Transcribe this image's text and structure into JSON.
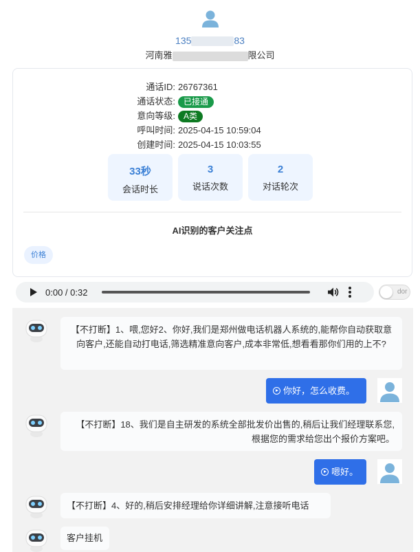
{
  "header": {
    "phone_prefix": "135",
    "phone_suffix": "83",
    "company_prefix": "河南雅",
    "company_suffix": "限公司"
  },
  "call_info": {
    "call_id_label": "通话ID:",
    "call_id": "26767361",
    "status_label": "通话状态:",
    "status": "已接通",
    "intent_label": "意向等级:",
    "intent": "A类",
    "call_time_label": "呼叫时间:",
    "call_time": "2025-04-15 10:59:04",
    "create_time_label": "创建时间:",
    "create_time": "2025-04-15 10:03:55"
  },
  "stats": [
    {
      "value": "33秒",
      "label": "会话时长"
    },
    {
      "value": "3",
      "label": "说话次数"
    },
    {
      "value": "2",
      "label": "对话轮次"
    }
  ],
  "focus": {
    "title": "AI识别的客户关注点",
    "tags": [
      "价格"
    ]
  },
  "player": {
    "time": "0:00 / 0:32"
  },
  "toggle": {
    "label": "dor"
  },
  "messages": [
    {
      "side": "bot",
      "text": "【不打断】1、喂,您好2、你好,我们是郑州做电话机器人系统的,能帮你自动获取意向客户,还能自动打电话,筛选精准意向客户,成本非常低,想看看那你们用的上不?"
    },
    {
      "side": "user",
      "text": "你好，怎么收费。"
    },
    {
      "side": "bot",
      "text": "【不打断】18、我们是自主研发的系统全部批发价出售的,稍后让我们经理联系您,根据您的需求给您出个报价方案吧。"
    },
    {
      "side": "user",
      "text": "嗯好。"
    },
    {
      "side": "bot",
      "text": "【不打断】4、好的,稍后安排经理给你详细讲解,注意接听电话"
    },
    {
      "side": "bot",
      "text": "客户挂机"
    }
  ],
  "colors": {
    "accent": "#2f6fe8",
    "status_green": "#1a9a4a",
    "intent_green": "#0d7a22",
    "stat_blue": "#3a7fd5"
  }
}
